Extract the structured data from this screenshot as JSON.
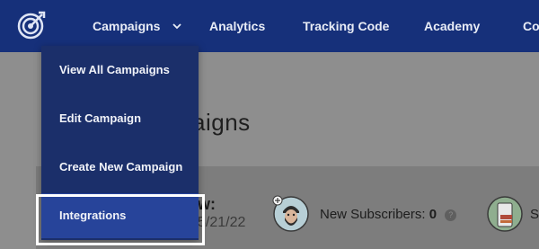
{
  "nav": {
    "campaigns": "Campaigns",
    "analytics": "Analytics",
    "tracking_code": "Tracking Code",
    "academy": "Academy",
    "more": "Co"
  },
  "dropdown": {
    "items": [
      {
        "label": "View All Campaigns"
      },
      {
        "label": "Edit Campaign"
      },
      {
        "label": "Create New Campaign"
      },
      {
        "label": "Integrations"
      }
    ]
  },
  "main": {
    "title_partial": "aigns",
    "card": {
      "date_label": "w:",
      "date_value": "5/21/22",
      "new_subscribers_label": "New Subscribers:",
      "new_subscribers_value": "0",
      "next_label_partial": "S"
    }
  },
  "colors": {
    "nav_bg": "#16307a",
    "dropdown_bg": "#1b2f6a",
    "dropdown_active": "#27449a",
    "overlay_gray": "#8a8a8a"
  },
  "icons": {
    "logo": "target-logo-icon",
    "chevron": "chevron-down-icon",
    "avatar": "bearded-avatar-icon",
    "phone": "phone-icon",
    "info": "info-icon"
  }
}
